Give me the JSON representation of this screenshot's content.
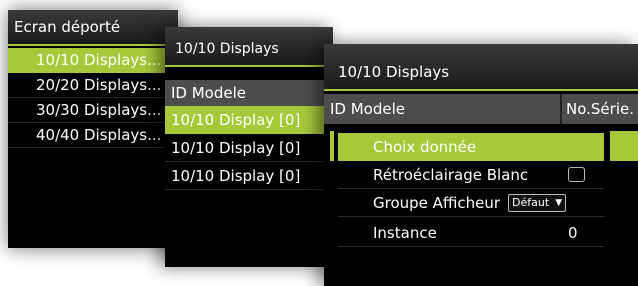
{
  "panel1": {
    "title": "Ecran déporté",
    "items": [
      "10/10 Displays...",
      "20/20 Displays...",
      "30/30 Displays...",
      "40/40 Displays..."
    ],
    "selected_index": 0
  },
  "panel2": {
    "title": "10/10 Displays",
    "header": "ID Modele",
    "items": [
      "10/10 Display [0]",
      "10/10 Display [0]",
      "10/10 Display [0]"
    ],
    "selected_index": 0
  },
  "panel3": {
    "title": "10/10 Displays",
    "header_col1": "ID Modele",
    "header_col2": "No.Série.",
    "menu": {
      "item1_label": "Choix donnée",
      "item2_label": "Rétroéclairage Blanc",
      "item2_checked": false,
      "item3_label": "Groupe Afficheur",
      "item3_value": "Défaut",
      "item4_label": "Instance",
      "item4_value": "0"
    }
  },
  "colors": {
    "accent": "#a6c93a",
    "panel_bg": "#000000",
    "header_bg": "#4d4d4d"
  }
}
